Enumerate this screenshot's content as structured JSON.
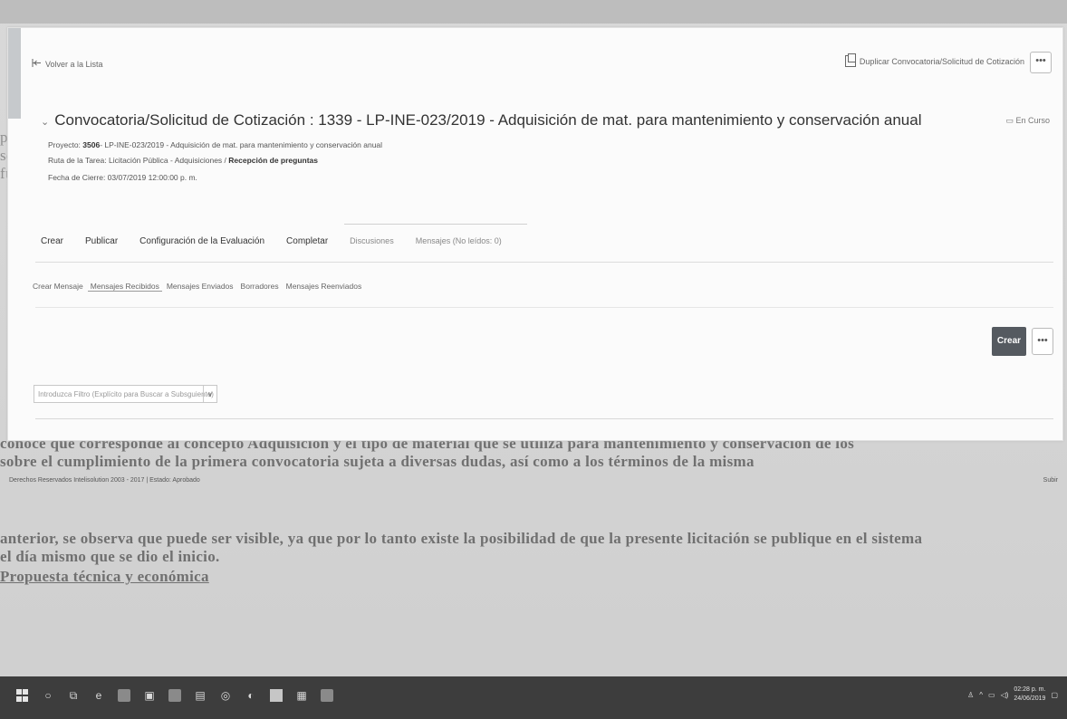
{
  "page": {
    "back_label": "Volver a la Lista",
    "duplicate_label": "Duplicar Convocatoria/Solicitud de Cotización",
    "more_label": "•••",
    "title": "Convocatoria/Solicitud de Cotización : 1339 - LP-INE-023/2019 - Adquisición de mat. para mantenimiento y conservación anual",
    "status": "En Curso",
    "project_label": "Proyecto:",
    "project_code": "3506",
    "project_desc": "- LP-INE-023/2019 - Adquisición de mat. para mantenimiento y conservación anual",
    "route_label": "Ruta de la Tarea:",
    "route_value": "Licitación Pública - Adquisiciones /",
    "route_current": "Recepción de preguntas",
    "close_date": "Fecha de Cierre: 03/07/2019 12:00:00 p. m."
  },
  "tabs": [
    "Crear",
    "Publicar",
    "Configuración de la Evaluación",
    "Completar",
    "Discusiones",
    "Mensajes (No leídos: 0)"
  ],
  "subtabs": [
    "Crear Mensaje",
    "Mensajes Recibidos",
    "Mensajes Enviados",
    "Borradores",
    "Mensajes Reenviados"
  ],
  "actions": {
    "create_label": "Crear"
  },
  "filter": {
    "placeholder": "Introduzca Filtro (Explícito para Buscar a Subsguiente)",
    "dropdown": "∨"
  },
  "footer": {
    "copyright": "Derechos Reservados Intelisolution 2003 - 2017 | Estado: Aprobado",
    "up": "Subir"
  },
  "taskbar": {
    "time": "02:28 p. m.",
    "date": "24/06/2019"
  }
}
